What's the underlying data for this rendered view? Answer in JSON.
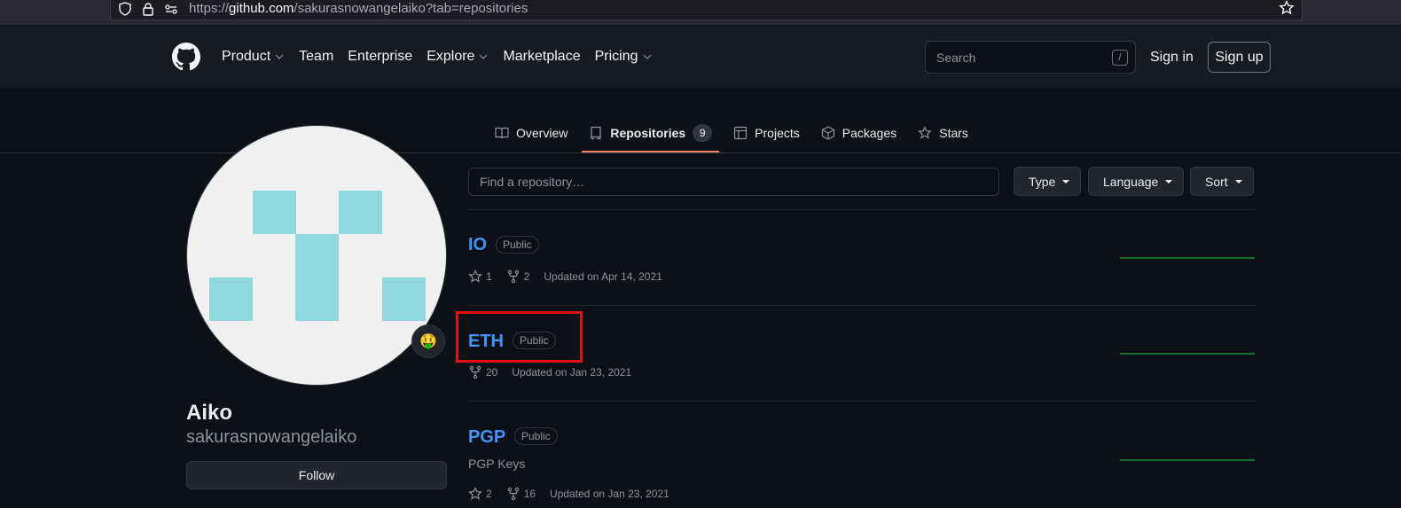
{
  "browser": {
    "url_prefix": "https://",
    "url_host": "github.com",
    "url_path": "/sakurasnowangelaiko?tab=repositories"
  },
  "header": {
    "nav": [
      "Product",
      "Team",
      "Enterprise",
      "Explore",
      "Marketplace",
      "Pricing"
    ],
    "search_placeholder": "Search",
    "search_shortcut": "/",
    "sign_in": "Sign in",
    "sign_up": "Sign up"
  },
  "tabs": [
    {
      "label": "Overview"
    },
    {
      "label": "Repositories",
      "count": "9"
    },
    {
      "label": "Projects"
    },
    {
      "label": "Packages"
    },
    {
      "label": "Stars"
    }
  ],
  "profile": {
    "name": "Aiko",
    "login": "sakurasnowangelaiko",
    "follow_label": "Follow",
    "status_emoji": "🤑"
  },
  "filters": {
    "find_placeholder": "Find a repository…",
    "type": "Type",
    "language": "Language",
    "sort": "Sort"
  },
  "repos": [
    {
      "name": "IO",
      "visibility": "Public",
      "stars": "1",
      "forks": "2",
      "updated": "Updated on Apr 14, 2021",
      "description": ""
    },
    {
      "name": "ETH",
      "visibility": "Public",
      "stars": "",
      "forks": "20",
      "updated": "Updated on Jan 23, 2021",
      "description": ""
    },
    {
      "name": "PGP",
      "visibility": "Public",
      "stars": "2",
      "forks": "16",
      "updated": "Updated on Jan 23, 2021",
      "description": "PGP Keys"
    }
  ],
  "colors": {
    "accent_link": "#4493f8",
    "tab_underline": "#f78166",
    "highlight_box": "#e01010",
    "avatar_identicon": "#8fd9dd"
  }
}
